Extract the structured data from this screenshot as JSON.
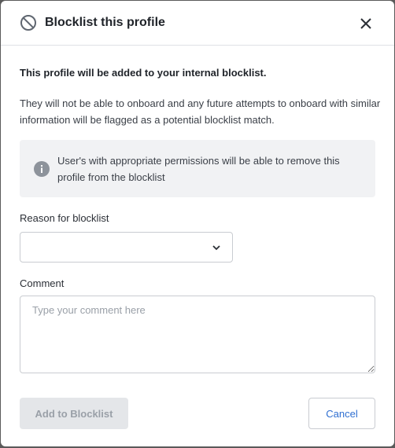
{
  "dialog": {
    "title": "Blocklist this profile",
    "title_icon": "ban-icon",
    "close_icon": "close-icon"
  },
  "content": {
    "intro": "This profile will be added to your internal blocklist.",
    "description": "They will not be able to onboard and any future attempts to onboard with similar information will be flagged as a potential blocklist match.",
    "info": {
      "icon": "info-icon",
      "text": "User's with appropriate permissions will be able to remove this profile from the blocklist"
    }
  },
  "form": {
    "reason": {
      "label": "Reason for blocklist",
      "value": "",
      "icon": "chevron-down-icon"
    },
    "comment": {
      "label": "Comment",
      "value": "",
      "placeholder": "Type your comment here"
    }
  },
  "footer": {
    "submit_label": "Add to Blocklist",
    "submit_disabled": true,
    "cancel_label": "Cancel"
  },
  "colors": {
    "link": "#2f6fd1",
    "info_background": "#f1f2f4",
    "disabled_button": "#e4e6e9"
  }
}
